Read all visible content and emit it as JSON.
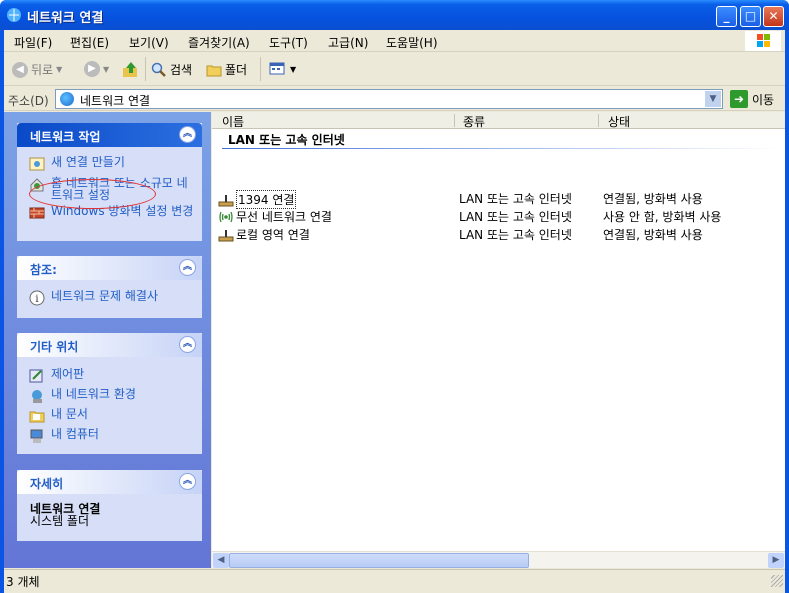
{
  "window": {
    "title": "네트워크 연결",
    "minimize_label": "_",
    "maximize_label": "□",
    "close_label": "✕"
  },
  "menubar": [
    {
      "label": "파일(F)"
    },
    {
      "label": "편집(E)"
    },
    {
      "label": "보기(V)"
    },
    {
      "label": "즐겨찾기(A)"
    },
    {
      "label": "도구(T)"
    },
    {
      "label": "고급(N)"
    },
    {
      "label": "도움말(H)"
    }
  ],
  "toolbar": {
    "back_label": "뒤로",
    "search_label": "검색",
    "folders_label": "폴더"
  },
  "address": {
    "label": "주소(D)",
    "value": "네트워크 연결",
    "go_label": "이동"
  },
  "tasks_panel": {
    "title": "네트워크 작업",
    "items": [
      {
        "label": "새 연결 만들기"
      },
      {
        "label": "홈 네트워크 또는 소규모 네트워크 설정"
      },
      {
        "label": "Windows 방화벽 설정 변경"
      }
    ]
  },
  "see_also_panel": {
    "title": "참조:",
    "items": [
      {
        "label": "네트워크 문제 해결사"
      }
    ]
  },
  "other_places_panel": {
    "title": "기타 위치",
    "items": [
      {
        "label": "제어판"
      },
      {
        "label": "내 네트워크 환경"
      },
      {
        "label": "내 문서"
      },
      {
        "label": "내 컴퓨터"
      }
    ]
  },
  "details_panel": {
    "title": "자세히",
    "name": "네트워크 연결",
    "type": "시스템 폴더"
  },
  "columns": {
    "name": "이름",
    "type": "종류",
    "status": "상태"
  },
  "group_header": "LAN 또는 고속 인터넷",
  "connections": [
    {
      "name": "1394 연결",
      "type": "LAN 또는 고속 인터넷",
      "status": "연결됨, 방화벽 사용"
    },
    {
      "name": "무선 네트워크 연결",
      "type": "LAN 또는 고속 인터넷",
      "status": "사용 안 함, 방화벽 사용"
    },
    {
      "name": "로컬 영역 연결",
      "type": "LAN 또는 고속 인터넷",
      "status": "연결됨, 방화벽 사용"
    }
  ],
  "statusbar": {
    "text": "3 개체"
  },
  "colors": {
    "titlebar": "#0a55e4",
    "task_link": "#215dc6",
    "panel_bg": "#d6dff7",
    "annotation_oval": "#e23232"
  }
}
